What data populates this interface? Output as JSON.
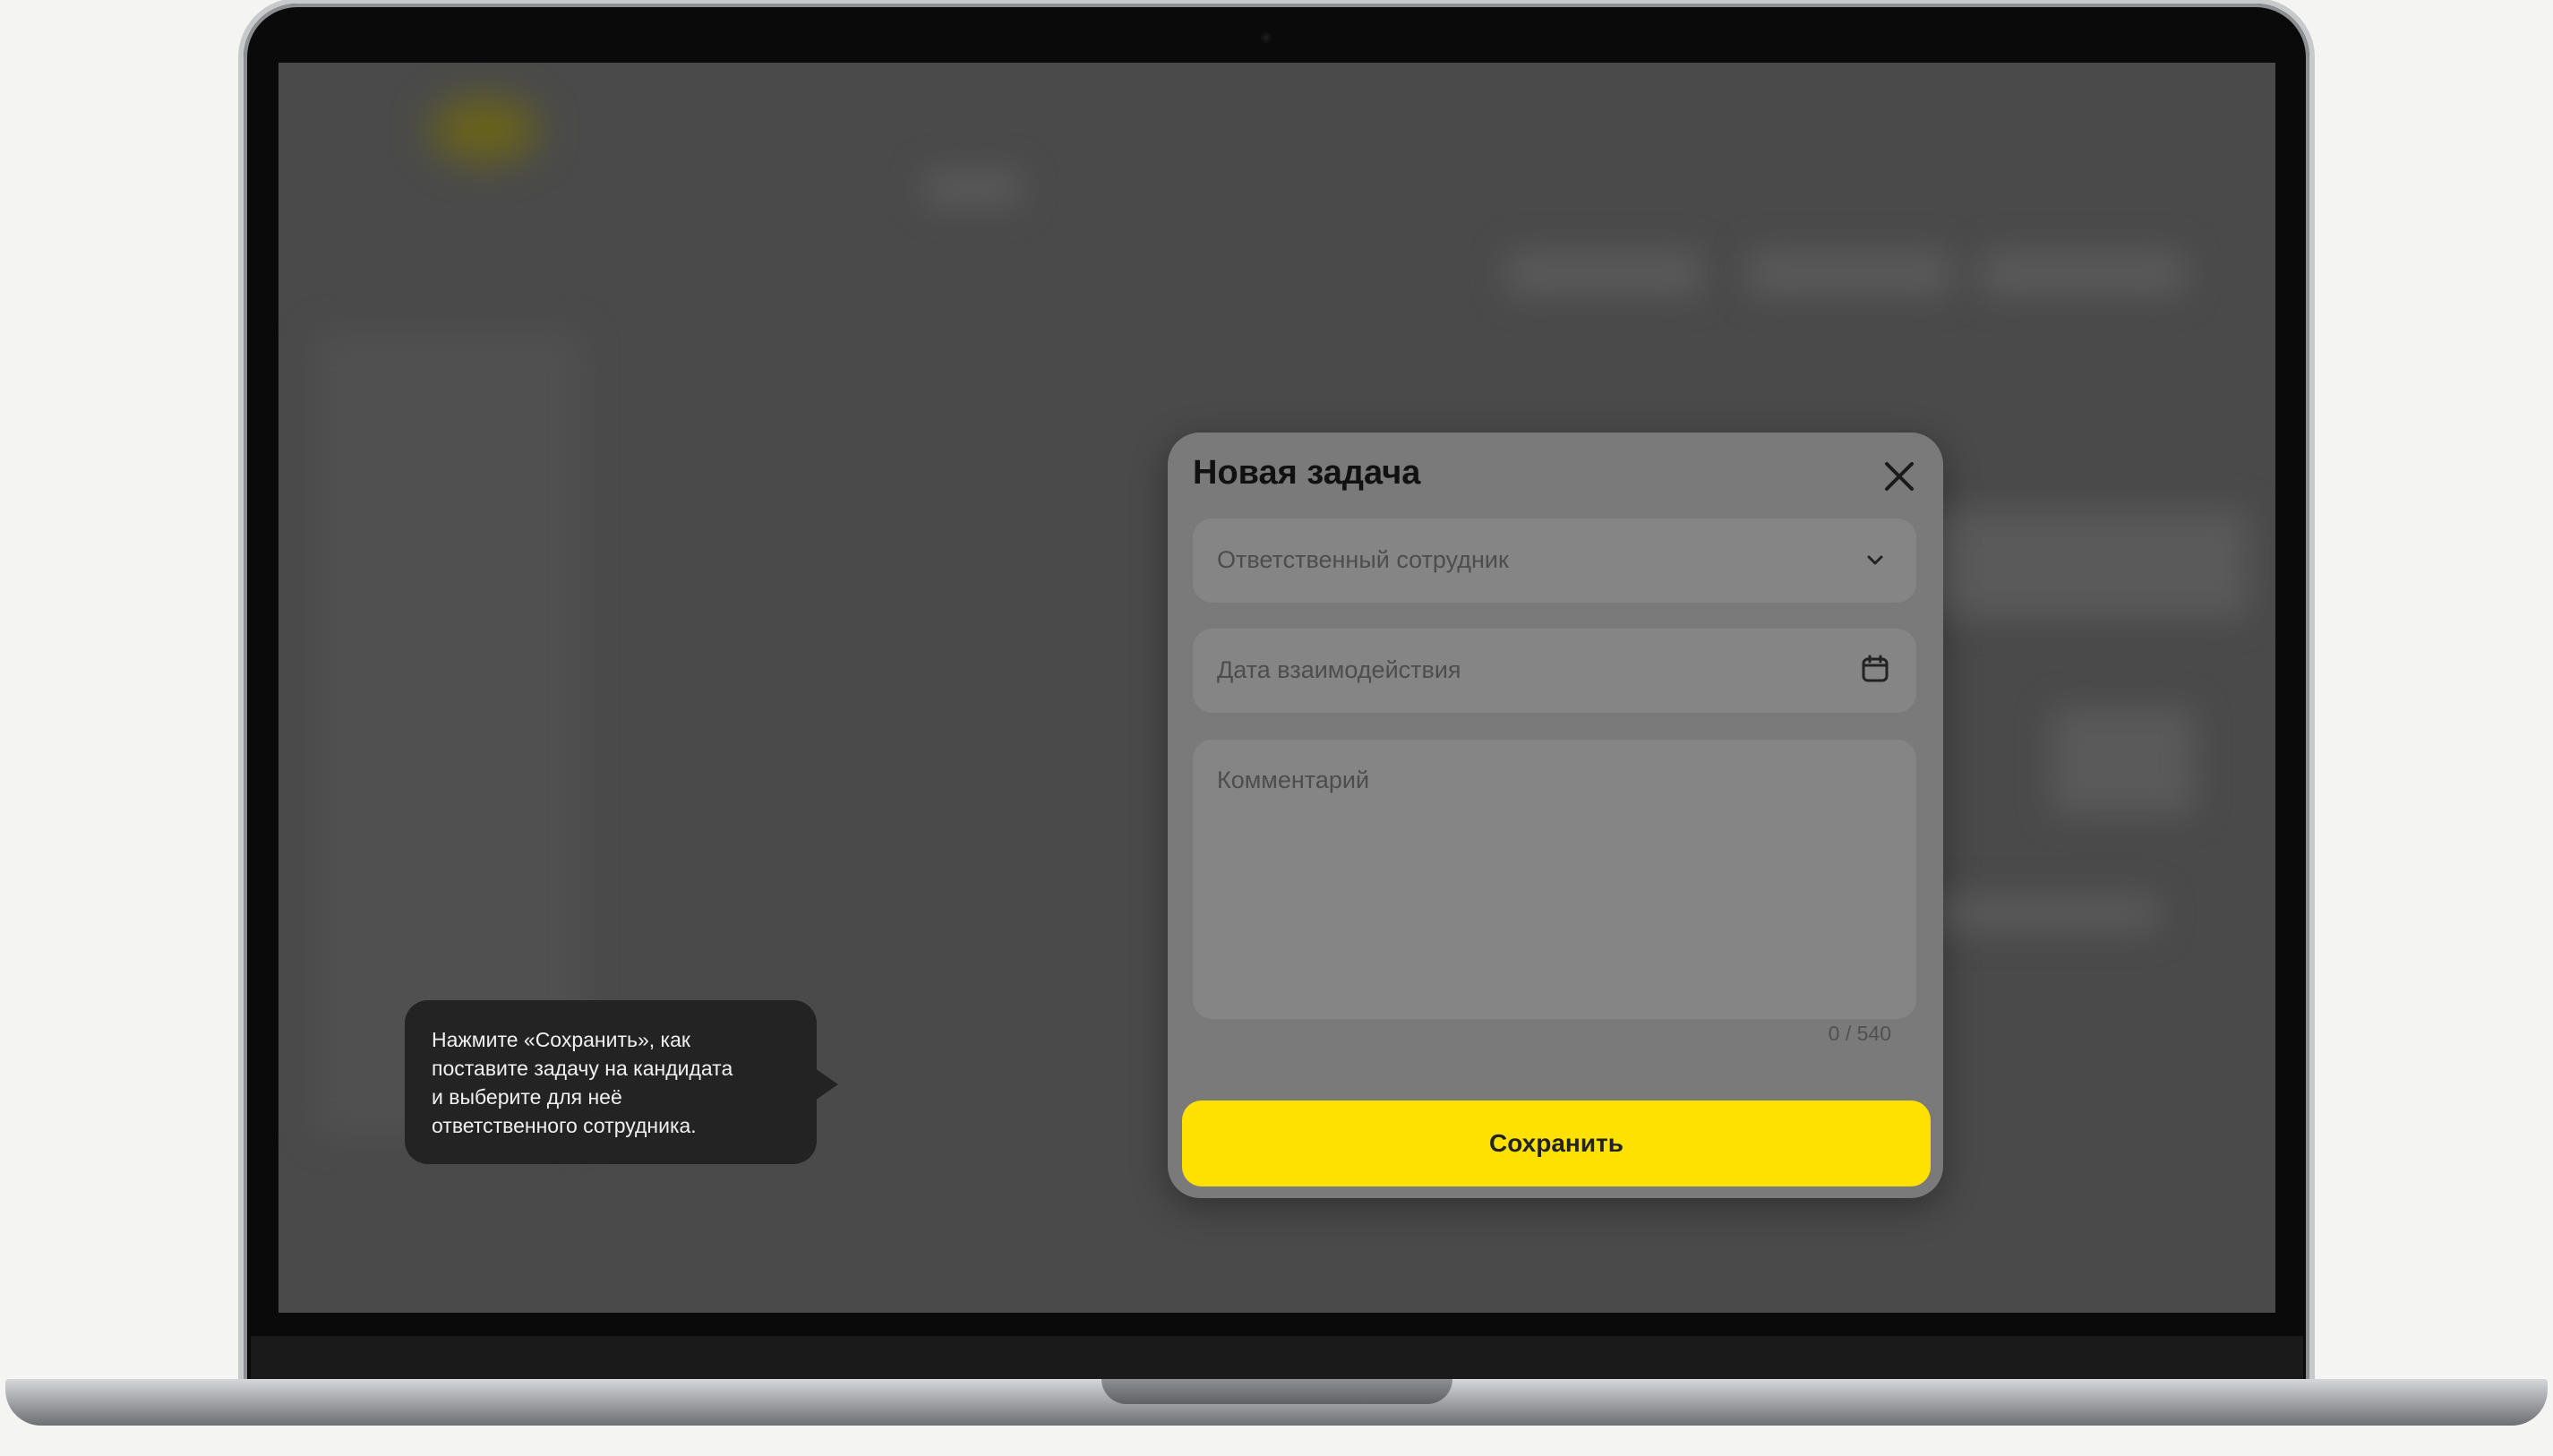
{
  "modal": {
    "title": "Новая задача",
    "responsible_placeholder": "Ответственный сотрудник",
    "date_placeholder": "Дата взаимодействия",
    "comment_placeholder": "Комментарий",
    "counter": "0 / 540",
    "save_label": "Сохранить"
  },
  "tooltip": {
    "lines": [
      "Нажмите «Сохранить», как",
      "поставите задачу на кандидата",
      "и выберите для неё",
      "ответственного сотрудника."
    ]
  },
  "icons": {
    "close": "close-icon",
    "dropdown": "chevron-down-icon",
    "date": "calendar-icon"
  },
  "colors": {
    "accent": "#ffe100",
    "overlay": "#4a4a4a",
    "tooltip_bg": "#232323"
  }
}
